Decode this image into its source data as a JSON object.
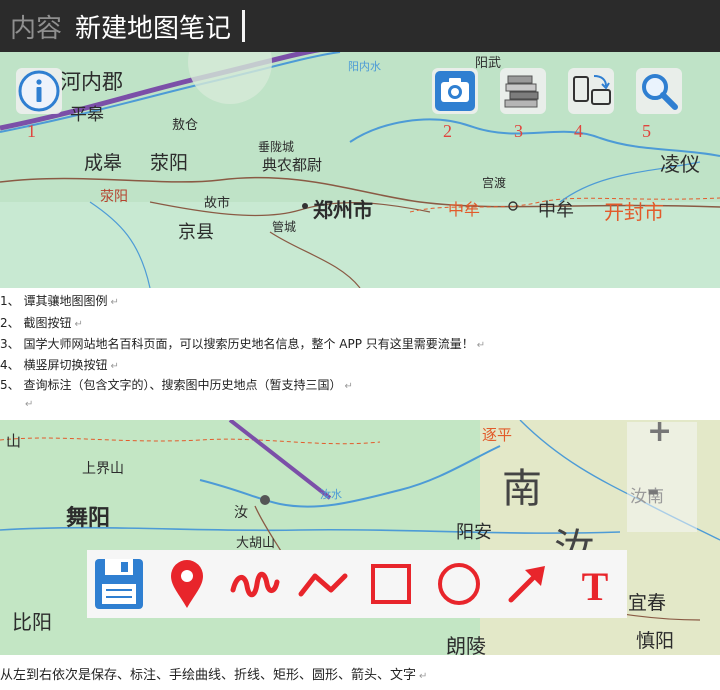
{
  "header": {
    "label": "内容",
    "title": "新建地图笔记"
  },
  "map_top": {
    "places": [
      "河内郡",
      "平皋",
      "敖仓",
      "成皋",
      "荥阳",
      "垂陇城",
      "典农都尉",
      "荥阳",
      "故市",
      "郑州市",
      "京县",
      "管城",
      "宫渡",
      "中牟",
      "中牟",
      "凌仪",
      "开封市",
      "阳武",
      "阳内水"
    ]
  },
  "tools": [
    {
      "icon": "info-icon",
      "number": "1"
    },
    {
      "icon": "camera-icon",
      "number": "2"
    },
    {
      "icon": "books-icon",
      "number": "3"
    },
    {
      "icon": "rotate-screen-icon",
      "number": "4"
    },
    {
      "icon": "search-icon",
      "number": "5"
    }
  ],
  "notes": [
    "1、 谭其骧地图图例",
    "2、 截图按钮",
    "3、 国学大师网站地名百科页面，可以搜索历史地名信息，整个 APP 只有这里需要流量！",
    "4、 横竖屏切换按钮",
    "5、 查询标注（包含文字的）、搜索图中历史地点（暂支持三国）",
    ""
  ],
  "map_bottom": {
    "places": [
      "山",
      "上界山",
      "舞阳",
      "汝",
      "大胡山",
      "阳安",
      "南",
      "汝",
      "逐平",
      "汝南",
      "宜春",
      "慎阳",
      "朗陵",
      "比阳",
      "汝水"
    ],
    "zoom_in": "+",
    "zoom_out": "-"
  },
  "draw_toolbar": [
    {
      "icon": "save-icon"
    },
    {
      "icon": "marker-icon"
    },
    {
      "icon": "freehand-curve-icon"
    },
    {
      "icon": "polyline-icon"
    },
    {
      "icon": "rectangle-icon"
    },
    {
      "icon": "circle-icon"
    },
    {
      "icon": "arrow-icon"
    },
    {
      "icon": "text-icon",
      "label": "T"
    }
  ],
  "caption": "从左到右依次是保存、标注、手绘曲线、折线、矩形、圆形、箭头、文字",
  "return_mark": "↵",
  "colors": {
    "header_bg": "#2b2b2b",
    "map_green": "#bfe3c7",
    "river": "#4d9bd6",
    "border_purple": "#7b4fa8",
    "draw_red": "#e8252b",
    "tool_blue": "#2f7fd1",
    "number_red": "#e0453e"
  }
}
